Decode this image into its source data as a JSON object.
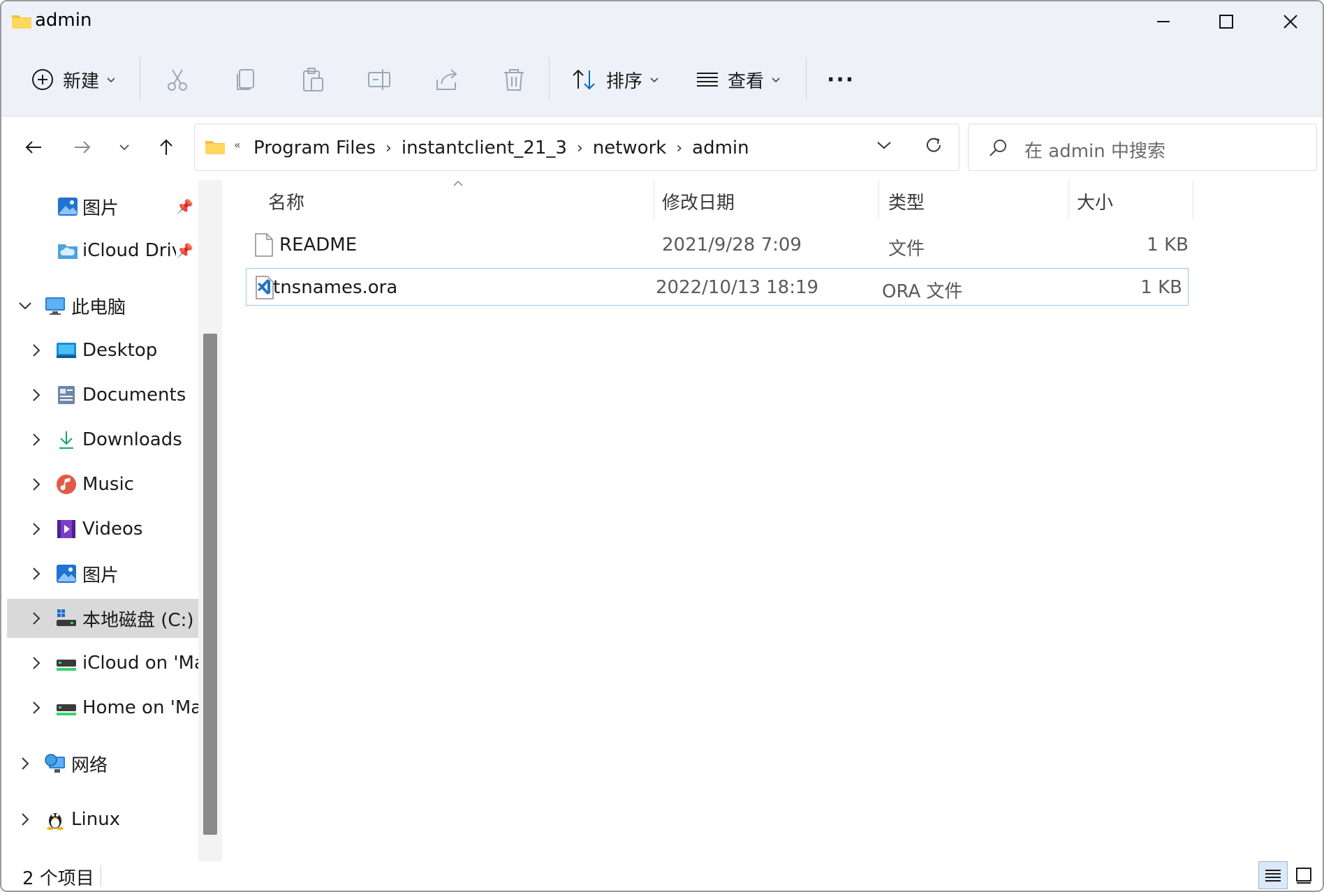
{
  "window": {
    "title": "admin"
  },
  "toolbar": {
    "new_label": "新建",
    "sort_label": "排序",
    "view_label": "查看",
    "more_label": "···"
  },
  "address": {
    "overflow": "«",
    "crumbs": [
      "Program Files",
      "instantclient_21_3",
      "network",
      "admin"
    ]
  },
  "search": {
    "placeholder": "在 admin 中搜索"
  },
  "sidebar": {
    "pinned": [
      {
        "label": "图片",
        "icon": "pictures-icon"
      },
      {
        "label": "iCloud Drive",
        "icon": "icloud-drive-icon"
      }
    ],
    "this_pc": {
      "label": "此电脑"
    },
    "children": [
      {
        "label": "Desktop",
        "icon": "desktop-icon"
      },
      {
        "label": "Documents",
        "icon": "documents-icon"
      },
      {
        "label": "Downloads",
        "icon": "downloads-icon"
      },
      {
        "label": "Music",
        "icon": "music-icon"
      },
      {
        "label": "Videos",
        "icon": "videos-icon"
      },
      {
        "label": "图片",
        "icon": "pictures-icon"
      },
      {
        "label": "本地磁盘 (C:)",
        "icon": "local-disk-icon"
      },
      {
        "label": "iCloud on 'Mac",
        "icon": "network-drive-icon"
      },
      {
        "label": "Home on 'Mac",
        "icon": "network-drive-icon"
      }
    ],
    "network": {
      "label": "网络"
    },
    "linux": {
      "label": "Linux"
    }
  },
  "columns": {
    "name": "名称",
    "modified": "修改日期",
    "type": "类型",
    "size": "大小"
  },
  "files": [
    {
      "name": "README",
      "modified": "2021/9/28 7:09",
      "type": "文件",
      "size": "1 KB",
      "icon": "blank-file-icon"
    },
    {
      "name": "tnsnames.ora",
      "modified": "2022/10/13 18:19",
      "type": "ORA 文件",
      "size": "1 KB",
      "icon": "vscode-file-icon"
    }
  ],
  "status": {
    "count": "2 个项目"
  },
  "colors": {
    "accent": "#0067c0",
    "folder": "#f3c140",
    "selected_border": "#99c9ef",
    "selected_nav": "#d9d9d9"
  }
}
